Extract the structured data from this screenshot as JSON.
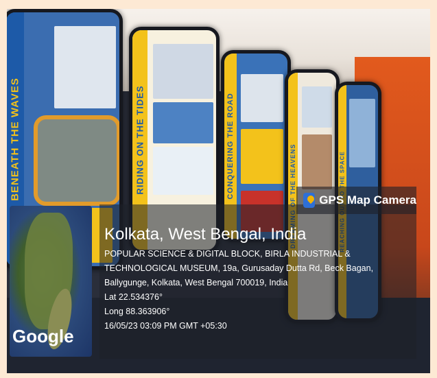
{
  "badge": {
    "label": "GPS Map Camera",
    "icon": "map-pin-icon"
  },
  "location": {
    "place": "Kolkata, West Bengal, India",
    "address": "POPULAR SCIENCE & DIGITAL BLOCK, BIRLA INDUSTRIAL & TECHNOLOGICAL MUSEUM, 19a, Gurusaday Dutta Rd, Beck Bagan, Ballygunge, Kolkata, West Bengal 700019, India",
    "lat": "Lat 22.534376°",
    "long": "Long 88.363906°",
    "timestamp": "16/05/23 03:09 PM GMT +05:30"
  },
  "map": {
    "brand": "Google"
  },
  "panels": {
    "p1": "BENEATH THE WAVES",
    "p2": "RIDING ON THE TIDES",
    "p3": "CONQUERING THE ROAD",
    "p4": "DREAMING OF THE HEAVENS",
    "p5": "REACHING OUT TO THE SPACE"
  },
  "colors": {
    "accent_yellow": "#f3c21b",
    "panel_blue": "#1d5aa8",
    "wall_orange": "#e25a1d",
    "page_border": "#fde9d4"
  }
}
